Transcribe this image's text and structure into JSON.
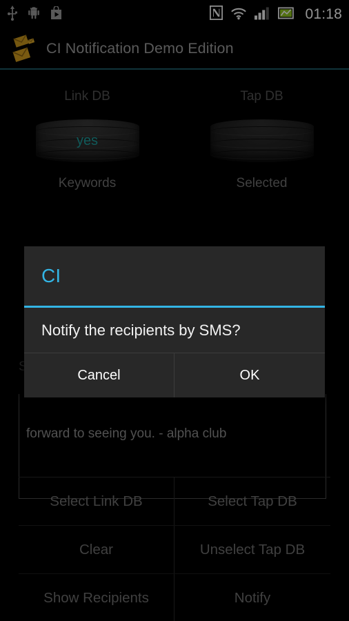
{
  "status_bar": {
    "icons_left": [
      "usb-icon",
      "android-robot-icon",
      "play-store-icon"
    ],
    "icons_right": [
      "nfc-icon",
      "wifi-icon",
      "signal-bars-icon",
      "battery-icon"
    ],
    "clock": "01:18"
  },
  "action_bar": {
    "icon": "mail-envelopes-icon",
    "title": "CI Notification Demo Edition",
    "accent_color": "#1d5a66"
  },
  "databases": [
    {
      "top_label": "Link DB",
      "value": "yes",
      "bottom_label": "Keywords",
      "value_color": "#1d9b9b",
      "icon": "database-cylinder-icon"
    },
    {
      "top_label": "Tap DB",
      "value": "",
      "bottom_label": "Selected",
      "value_color": "#1d9b9b",
      "icon": "database-cylinder-icon"
    }
  ],
  "message_form": {
    "field_label_visible": "S",
    "text_line_1": "",
    "text_line_2": "forward to seeing you. - alpha club"
  },
  "buttons": [
    [
      {
        "label": "Select Link DB"
      },
      {
        "label": "Select Tap DB"
      }
    ],
    [
      {
        "label": "Clear"
      },
      {
        "label": "Unselect Tap DB"
      }
    ],
    [
      {
        "label": "Show Recipients"
      },
      {
        "label": "Notify"
      }
    ]
  ],
  "dialog": {
    "title": "CI",
    "title_color": "#33b5e5",
    "message": "Notify the recipients by SMS?",
    "cancel_label": "Cancel",
    "ok_label": "OK"
  }
}
